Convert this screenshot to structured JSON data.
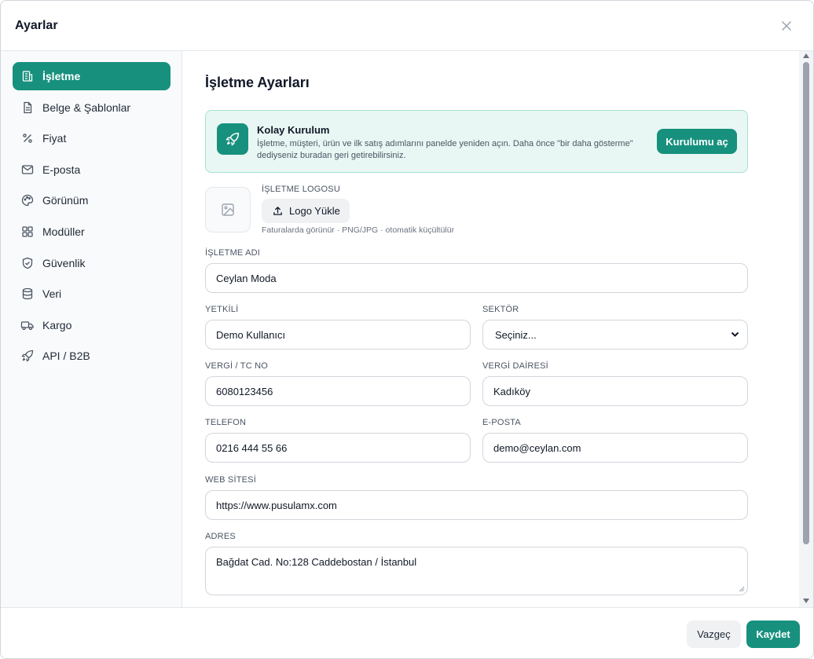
{
  "dialog": {
    "title": "Ayarlar"
  },
  "sidebar": {
    "items": [
      {
        "label": "İşletme",
        "icon": "building-icon",
        "active": true
      },
      {
        "label": "Belge & Şablonlar",
        "icon": "document-icon"
      },
      {
        "label": "Fiyat",
        "icon": "percent-icon"
      },
      {
        "label": "E-posta",
        "icon": "mail-icon"
      },
      {
        "label": "Görünüm",
        "icon": "palette-icon"
      },
      {
        "label": "Modüller",
        "icon": "grid-icon"
      },
      {
        "label": "Güvenlik",
        "icon": "shield-icon"
      },
      {
        "label": "Veri",
        "icon": "database-icon"
      },
      {
        "label": "Kargo",
        "icon": "truck-icon"
      },
      {
        "label": "API / B2B",
        "icon": "rocket-icon"
      }
    ]
  },
  "main": {
    "title": "İşletme Ayarları",
    "setup": {
      "title": "Kolay Kurulum",
      "description": "İşletme, müşteri, ürün ve ilk satış adımlarını panelde yeniden açın. Daha önce \"bir daha gösterme\" dediyseniz buradan geri getirebilirsiniz.",
      "button": "Kurulumu aç"
    },
    "logo": {
      "label": "İŞLETME LOGOSU",
      "button": "Logo Yükle",
      "hint": "Faturalarda görünür · PNG/JPG · otomatik küçültülür"
    },
    "fields": {
      "business_name": {
        "label": "İŞLETME ADI",
        "value": "Ceylan Moda"
      },
      "contact": {
        "label": "YETKİLİ",
        "value": "Demo Kullanıcı"
      },
      "sector": {
        "label": "SEKTÖR",
        "value": "Seçiniz..."
      },
      "tax_no": {
        "label": "VERGİ / TC NO",
        "value": "6080123456"
      },
      "tax_office": {
        "label": "VERGİ DAİRESİ",
        "value": "Kadıköy"
      },
      "phone": {
        "label": "TELEFON",
        "value": "0216 444 55 66"
      },
      "email": {
        "label": "E-POSTA",
        "value": "demo@ceylan.com"
      },
      "website": {
        "label": "WEB SİTESİ",
        "value": "https://www.pusulamx.com"
      },
      "address": {
        "label": "ADRES",
        "value": "Bağdat Cad. No:128 Caddebostan / İstanbul"
      }
    }
  },
  "footer": {
    "cancel": "Vazgeç",
    "save": "Kaydet"
  },
  "colors": {
    "accent": "#17917e",
    "accent_light": "#e8f7f3"
  }
}
